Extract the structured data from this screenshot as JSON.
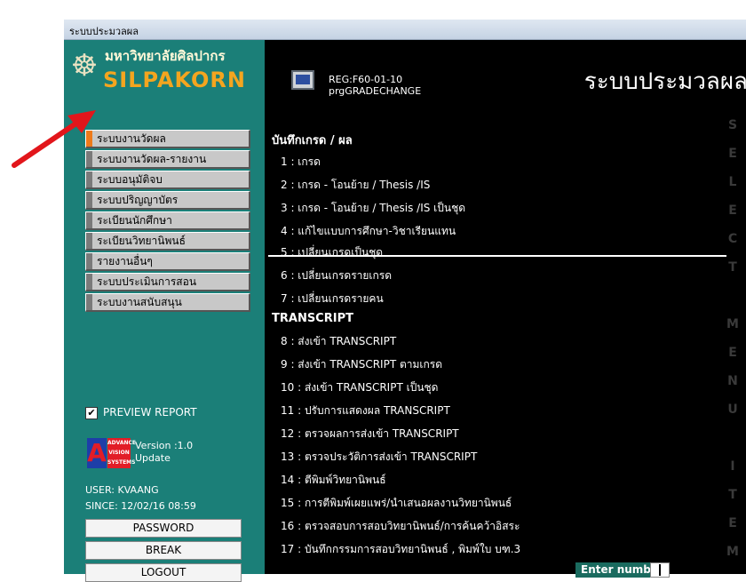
{
  "window": {
    "title": "ระบบประมวลผล"
  },
  "brand": {
    "university_name": "มหาวิทยาลัยศิลปากร",
    "name": "SILPAKORN"
  },
  "program": {
    "code": "REG:F60-01-10",
    "name": "prgGRADECHANGE"
  },
  "system_title": "ระบบประมวลผล",
  "sidebar": {
    "menu": [
      {
        "label": "ระบบงานวัดผล",
        "active": true
      },
      {
        "label": "ระบบงานวัดผล-รายงาน"
      },
      {
        "label": "ระบบอนุมัติจบ"
      },
      {
        "label": "ระบบปริญญาบัตร"
      },
      {
        "label": "ระเบียนนักศึกษา"
      },
      {
        "label": "ระเบียนวิทยานิพนธ์"
      },
      {
        "label": "รายงานอื่นๆ"
      },
      {
        "label": "ระบบประเมินการสอน"
      },
      {
        "label": "ระบบงานสนับสนุน"
      }
    ],
    "preview_report": {
      "label": "PREVIEW REPORT",
      "checked": true
    },
    "vendor": {
      "logo_letter": "A",
      "logo_words": [
        "ADVANCE",
        "VISION",
        "SYSTEMS"
      ],
      "version": "Version :1.0",
      "update": "Update"
    },
    "user": "USER: KVAANG",
    "since": "SINCE: 12/02/16 08:59",
    "buttons": {
      "password": "PASSWORD",
      "break": "BREAK",
      "logout": "LOGOUT"
    }
  },
  "sections": {
    "grades": {
      "heading": "บันทึกเกรด / ผล",
      "items": [
        "1 : เกรด",
        "2 : เกรด - โอนย้าย / Thesis /IS",
        "3 : เกรด - โอนย้าย / Thesis /IS เป็นชุด",
        "4 : แก้ไขแบบการศึกษา-วิชาเรียนแทน",
        "5 : เปลี่ยนเกรดเป็นชุด",
        "6 : เปลี่ยนเกรดรายเกรด",
        "7 : เปลี่ยนเกรดรายคน"
      ]
    },
    "transcript": {
      "heading": "TRANSCRIPT",
      "items": [
        "8 : ส่งเข้า TRANSCRIPT",
        "9 : ส่งเข้า TRANSCRIPT ตามเกรด",
        "10 : ส่งเข้า TRANSCRIPT เป็นชุด",
        "11 : ปรับการแสดงผล TRANSCRIPT",
        "12 : ตรวจผลการส่งเข้า TRANSCRIPT",
        "13 : ตรวจประวัติการส่งเข้า TRANSCRIPT",
        "14 : ตีพิมพ์วิทยานิพนธ์",
        "15 : การตีพิมพ์เผยแพร่/นำเสนอผลงานวิทยานิพนธ์",
        "16 : ตรวจสอบการสอบวิทยานิพนธ์/การค้นคว้าอิสระ",
        "17 : บันทึกกรรมการสอบวิทยานิพนธ์ , พิมพ์ใบ บฑ.3"
      ]
    }
  },
  "side_watermark": [
    "S",
    "E",
    "L",
    "E",
    "C",
    "T",
    "",
    "M",
    "E",
    "N",
    "U",
    "",
    "I",
    "T",
    "E",
    "M"
  ],
  "enter_number": {
    "label": "Enter number",
    "value": ""
  },
  "colors": {
    "sidebar": "#1b7f78",
    "accent": "#ee7a1a",
    "brand": "#f4a51f",
    "arrow": "#e2161b"
  }
}
